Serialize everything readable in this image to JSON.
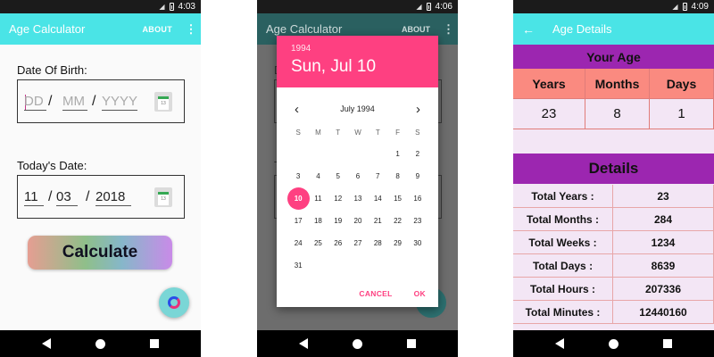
{
  "screen1": {
    "status_time": "4:03",
    "app_title": "Age Calculator",
    "about_label": "ABOUT",
    "dob_label": "Date Of Birth:",
    "dob_placeholders": {
      "day": "DD",
      "month": "MM",
      "year": "YYYY"
    },
    "today_label": "Today's Date:",
    "today_values": {
      "day": "11",
      "month": "03",
      "year": "2018"
    },
    "separator": "/",
    "calendar_icon_text": "13",
    "calculate_label": "Calculate"
  },
  "screen2": {
    "status_time": "4:06",
    "app_title": "Age Calculator",
    "about_label": "ABOUT",
    "ghost_letter_1": "D",
    "ghost_letter_2": "T",
    "dialog": {
      "year": "1994",
      "date": "Sun, Jul 10",
      "month_label": "July 1994",
      "weekdays": [
        "S",
        "M",
        "T",
        "W",
        "T",
        "F",
        "S"
      ],
      "days": [
        "",
        "",
        "",
        "",
        "",
        "1",
        "2",
        "3",
        "4",
        "5",
        "6",
        "7",
        "8",
        "9",
        "10",
        "11",
        "12",
        "13",
        "14",
        "15",
        "16",
        "17",
        "18",
        "19",
        "20",
        "21",
        "22",
        "23",
        "24",
        "25",
        "26",
        "27",
        "28",
        "29",
        "30",
        "31"
      ],
      "selected_day": "10",
      "cancel_label": "CANCEL",
      "ok_label": "OK"
    }
  },
  "screen3": {
    "status_time": "4:09",
    "app_title": "Age Details",
    "your_age_heading": "Your Age",
    "age_headers": [
      "Years",
      "Months",
      "Days"
    ],
    "age_values": [
      "23",
      "8",
      "1"
    ],
    "details_heading": "Details",
    "details": [
      {
        "label": "Total Years :",
        "value": "23"
      },
      {
        "label": "Total Months :",
        "value": "284"
      },
      {
        "label": "Total Weeks :",
        "value": "1234"
      },
      {
        "label": "Total Days :",
        "value": "8639"
      },
      {
        "label": "Total Hours :",
        "value": "207336"
      },
      {
        "label": "Total Minutes :",
        "value": "12440160"
      }
    ]
  },
  "colors": {
    "appbar": "#4ae4e6",
    "accent": "#fe4081",
    "purple_header": "#9c26b0",
    "salmon_header": "#fa8a80"
  },
  "icons": {
    "status": [
      "signal-icon",
      "battery-icon"
    ],
    "nav": [
      "nav-back-icon",
      "nav-home-icon",
      "nav-recents-icon"
    ]
  }
}
